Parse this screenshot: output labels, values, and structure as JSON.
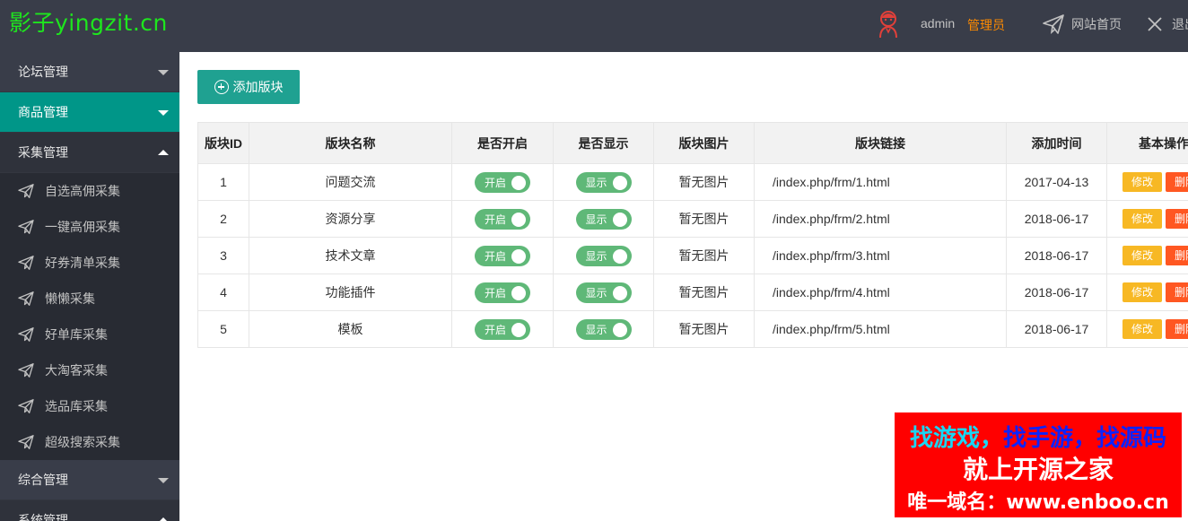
{
  "header": {
    "logo": "影子yingzit.cn",
    "username": "admin",
    "role": "管理员",
    "home_link": "网站首页",
    "logout_link": "退出"
  },
  "sidebar": {
    "groups": [
      {
        "label": "论坛管理",
        "state": "collapsed"
      },
      {
        "label": "商品管理",
        "state": "active"
      },
      {
        "label": "采集管理",
        "state": "open"
      },
      {
        "label": "综合管理",
        "state": "collapsed"
      },
      {
        "label": "系统管理",
        "state": "open"
      }
    ],
    "sub_items": [
      {
        "label": "自选高佣采集"
      },
      {
        "label": "一键高佣采集"
      },
      {
        "label": "好券清单采集"
      },
      {
        "label": "懒懒采集"
      },
      {
        "label": "好单库采集"
      },
      {
        "label": "大淘客采集"
      },
      {
        "label": "选品库采集"
      },
      {
        "label": "超级搜索采集"
      }
    ]
  },
  "toolbar": {
    "add_label": "添加版块"
  },
  "table": {
    "headers": [
      "版块ID",
      "版块名称",
      "是否开启",
      "是否显示",
      "版块图片",
      "版块链接",
      "添加时间",
      "基本操作"
    ],
    "rows": [
      {
        "id": "1",
        "name": "问题交流",
        "enabled": "开启",
        "visible": "显示",
        "image": "暂无图片",
        "link": "/index.php/frm/1.html",
        "date": "2017-04-13",
        "edit": "修改",
        "delete": "删除"
      },
      {
        "id": "2",
        "name": "资源分享",
        "enabled": "开启",
        "visible": "显示",
        "image": "暂无图片",
        "link": "/index.php/frm/2.html",
        "date": "2018-06-17",
        "edit": "修改",
        "delete": "删除"
      },
      {
        "id": "3",
        "name": "技术文章",
        "enabled": "开启",
        "visible": "显示",
        "image": "暂无图片",
        "link": "/index.php/frm/3.html",
        "date": "2018-06-17",
        "edit": "修改",
        "delete": "删除"
      },
      {
        "id": "4",
        "name": "功能插件",
        "enabled": "开启",
        "visible": "显示",
        "image": "暂无图片",
        "link": "/index.php/frm/4.html",
        "date": "2018-06-17",
        "edit": "修改",
        "delete": "删除"
      },
      {
        "id": "5",
        "name": "模板",
        "enabled": "开启",
        "visible": "显示",
        "image": "暂无图片",
        "link": "/index.php/frm/5.html",
        "date": "2018-06-17",
        "edit": "修改",
        "delete": "删除"
      }
    ]
  },
  "watermark": {
    "line1_part1": "找游戏，",
    "line1_part2": "找手游，找源码",
    "line2": "就上开源之家",
    "line3": "唯一域名：www.enboo.cn"
  },
  "colors": {
    "header_bg": "#393d49",
    "accent": "#009688",
    "switch_on": "#5fb878",
    "edit": "#f7b824",
    "delete": "#ff5722",
    "role": "#ff8b00",
    "logo": "#1ee61e"
  }
}
